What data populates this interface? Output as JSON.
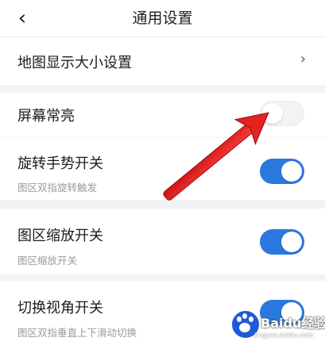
{
  "header": {
    "back_icon": "‹",
    "title": "通用设置"
  },
  "settings": {
    "map_size": {
      "label": "地图显示大小设置",
      "chevron": "›"
    },
    "screen_on": {
      "label": "屏幕常亮",
      "enabled": false
    },
    "rotate": {
      "label": "旋转手势开关",
      "desc": "图区双指旋转触发",
      "enabled": true
    },
    "zoom": {
      "label": "图区缩放开关",
      "desc": "图区缩放开关",
      "enabled": true
    },
    "view_angle": {
      "label": "切换视角开关",
      "desc": "图区双指垂直上下滑动切换",
      "enabled": true
    }
  },
  "watermark": {
    "text": "Baidu经验",
    "url": "jingyan.baidu.com"
  },
  "colors": {
    "toggle_on": "#2a78e0",
    "toggle_off": "#f3f3f4",
    "arrow": "#e32222"
  }
}
